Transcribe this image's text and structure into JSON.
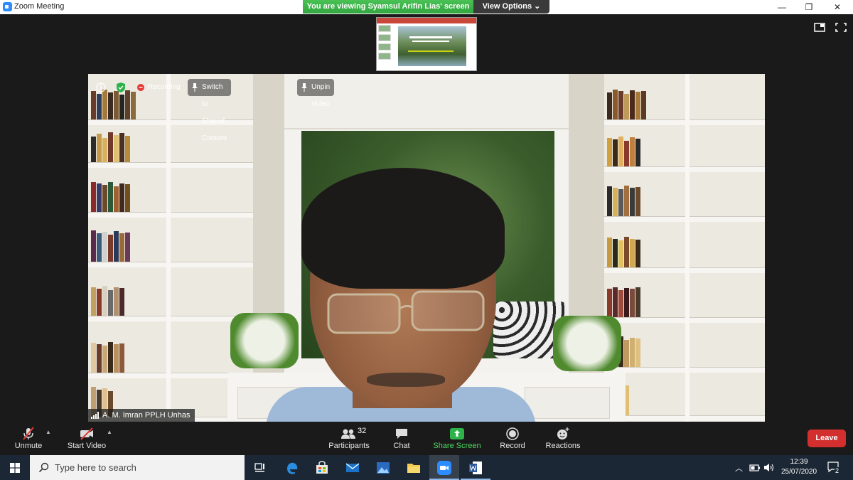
{
  "window": {
    "title": "Zoom Meeting",
    "minimize": "—",
    "restore": "❐",
    "close": "✕"
  },
  "banner": {
    "viewing_text": "You are viewing Syamsul Arifin Lias' screen",
    "view_options": "View Options ⌄"
  },
  "video_overlay": {
    "info": "i",
    "recording": "Recording",
    "switch_shared": "Switch to Shared Content",
    "unpin_video": "Unpin Video"
  },
  "participant": {
    "name": "A. M. Imran PPLH Unhas"
  },
  "toolbar": {
    "unmute": "Unmute",
    "start_video": "Start Video",
    "participants": "Participants",
    "participants_count": "32",
    "chat": "Chat",
    "share_screen": "Share Screen",
    "record": "Record",
    "reactions": "Reactions",
    "leave": "Leave"
  },
  "taskbar": {
    "search_placeholder": "Type here to search",
    "time": "12:39",
    "date": "25/07/2020",
    "notifications": "2"
  },
  "colors": {
    "zoom_blue": "#2d8cff",
    "banner_green": "#33a640",
    "share_green": "#2db34a",
    "leave_red": "#d32f2f"
  }
}
